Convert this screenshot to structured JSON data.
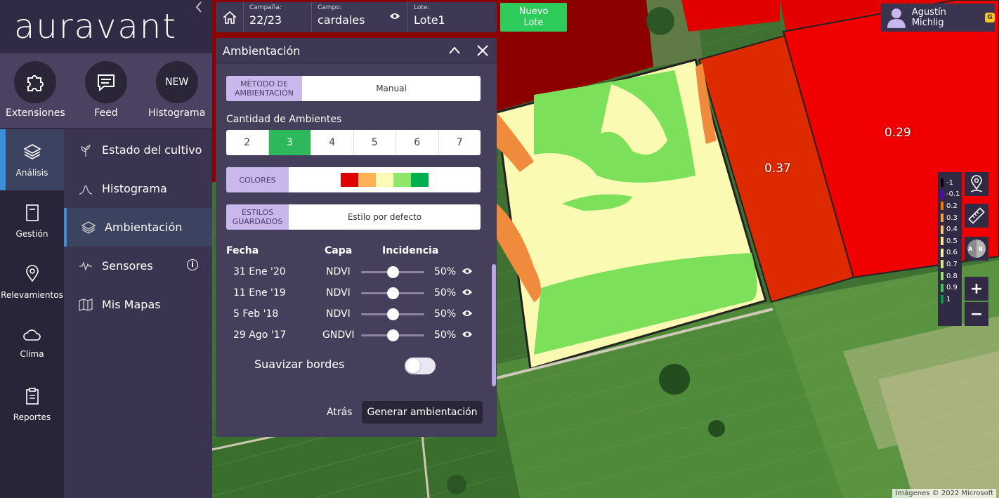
{
  "brand": {
    "logo": "auravant"
  },
  "shortcuts": [
    {
      "label": "Extensiones",
      "icon": "puzzle-icon"
    },
    {
      "label": "Feed",
      "icon": "chat-icon"
    },
    {
      "label": "Histograma",
      "icon_text": "NEW"
    }
  ],
  "leftnav": [
    {
      "label": "Análisis",
      "icon": "layers-icon"
    },
    {
      "label": "Gestión",
      "icon": "notebook-icon"
    },
    {
      "label": "Relevamientos",
      "icon": "pin-icon"
    },
    {
      "label": "Clima",
      "icon": "cloud-icon"
    },
    {
      "label": "Reportes",
      "icon": "clipboard-icon"
    }
  ],
  "subnav": [
    {
      "label": "Estado del cultivo"
    },
    {
      "label": "Histograma"
    },
    {
      "label": "Ambientación"
    },
    {
      "label": "Sensores"
    },
    {
      "label": "Mis Mapas"
    }
  ],
  "topbar": {
    "campana_caption": "Campaña:",
    "campana_value": "22/23",
    "campo_caption": "Campo:",
    "campo_value": "cardales",
    "lote_caption": "Lote:",
    "lote_value": "Lote1",
    "nuevo_line1": "Nuevo",
    "nuevo_line2": "Lote"
  },
  "user": {
    "name": "Agustín Michlig",
    "badge": "G"
  },
  "panel": {
    "title": "Ambientación",
    "metodo_tag_line1": "MÉTODO DE",
    "metodo_tag_line2": "AMBIENTACIÓN",
    "metodo_value": "Manual",
    "cantidad_label": "Cantidad de Ambientes",
    "ambientes": [
      "2",
      "3",
      "4",
      "5",
      "6",
      "7"
    ],
    "colores_tag": "COLORES",
    "colores": [
      "#e00000",
      "#ffb157",
      "#fbfbb7",
      "#8fe66b",
      "#00b050"
    ],
    "estilos_tag_line1": "ESTILOS",
    "estilos_tag_line2": "GUARDADOS",
    "estilos_value": "Estilo por defecto",
    "headers": {
      "fecha": "Fecha",
      "capa": "Capa",
      "incidencia": "Incidencia"
    },
    "rows": [
      {
        "fecha": "31 Ene '20",
        "capa": "NDVI",
        "incidencia": "50%",
        "value": 50
      },
      {
        "fecha": "11 Ene '19",
        "capa": "NDVI",
        "incidencia": "50%",
        "value": 50
      },
      {
        "fecha": "5 Feb '18",
        "capa": "NDVI",
        "incidencia": "50%",
        "value": 50
      },
      {
        "fecha": "29 Ago '17",
        "capa": "GNDVI",
        "incidencia": "50%",
        "value": 50
      }
    ],
    "suavizar_label": "Suavizar bordes",
    "atras": "Atrás",
    "generar": "Generar ambientación"
  },
  "map": {
    "lot_labels": [
      "0.37",
      "0.29"
    ],
    "attribution": "Imágenes © 2022 Microsoft"
  },
  "legend": [
    {
      "label": "-1",
      "color": "#000000"
    },
    {
      "label": "-0.1",
      "color": "#5a00c8"
    },
    {
      "label": "0.2",
      "color": "#f07d00"
    },
    {
      "label": "0.3",
      "color": "#f5a142"
    },
    {
      "label": "0.4",
      "color": "#ffc466"
    },
    {
      "label": "0.5",
      "color": "#ffe88a"
    },
    {
      "label": "0.6",
      "color": "#e8f5a0"
    },
    {
      "label": "0.7",
      "color": "#c9ed87"
    },
    {
      "label": "0.8",
      "color": "#8fe66b"
    },
    {
      "label": "0.9",
      "color": "#3fcc47"
    },
    {
      "label": "1",
      "color": "#00a03a"
    }
  ],
  "tools": {
    "zoom_in": "+",
    "zoom_out": "−",
    "ab_label": "A B"
  }
}
